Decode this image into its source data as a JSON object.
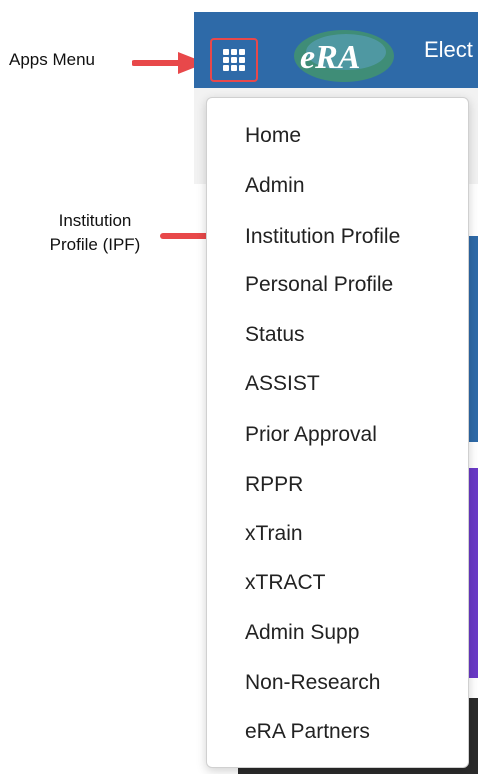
{
  "annotations": {
    "apps_menu": "Apps Menu",
    "institution_profile_line1": "Institution",
    "institution_profile_line2": "Profile (IPF)"
  },
  "header": {
    "logo_text": "eRA",
    "title": "Elect",
    "apps_icon": "grid-icon",
    "color": "#2e6aa8"
  },
  "menu": {
    "items": [
      "Home",
      "Admin",
      "Institution Profile",
      "Personal Profile",
      "Status",
      "ASSIST",
      "Prior Approval",
      "RPPR",
      "xTrain",
      "xTRACT",
      "Admin Supp",
      "Non-Research",
      "eRA Partners"
    ]
  },
  "colors": {
    "arrow": "#e8484a",
    "purple_band": "#6a39c7",
    "dark_band": "#2b2b2b"
  }
}
